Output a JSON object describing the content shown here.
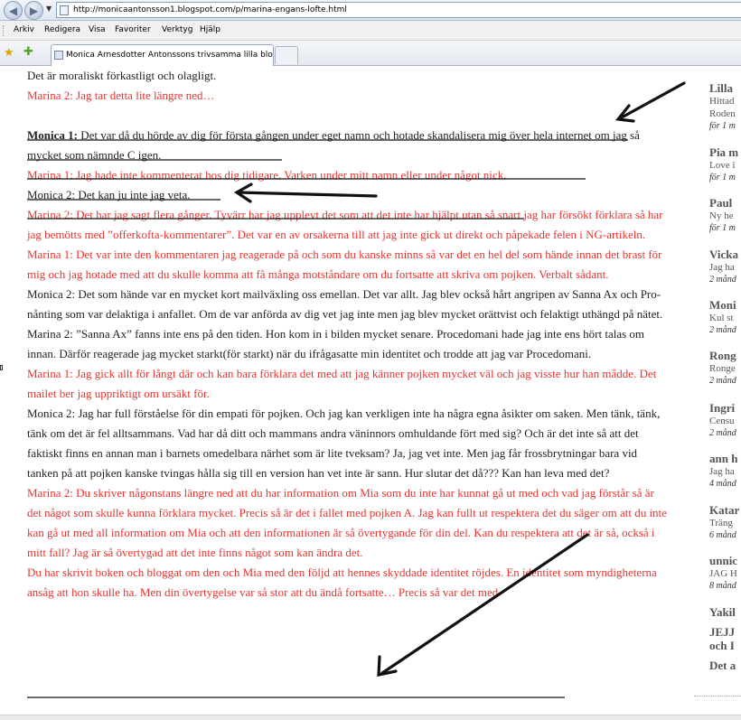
{
  "browser": {
    "url": "http://monicaantonsson1.blogspot.com/p/marina-engans-lofte.html",
    "menu": [
      "Arkiv",
      "Redigera",
      "Visa",
      "Favoriter",
      "Verktyg",
      "Hjälp"
    ],
    "tab_title": "Monica Arnesdotter Antonssons trivsamma lilla blogg: ...",
    "icons": {
      "back": "back-arrow-icon",
      "forward": "forward-arrow-icon",
      "favorites": "star-icon",
      "add_favorite": "add-favorite-icon"
    }
  },
  "content": {
    "paragraphs": [
      {
        "text": "Det är moraliskt förkastligt och olagligt.",
        "color": "#222222"
      },
      {
        "text": "Marina 2: Jag tar detta lite längre ned…",
        "color": "#e8342f"
      },
      {
        "text": "",
        "color": "#222222"
      },
      {
        "speaker": "Monica 1:",
        "text": " Det var då du hörde av dig för första gången under eget namn och hotade skandalisera mig över hela internet om jag så mycket som nämnde C igen.",
        "color": "#222222"
      },
      {
        "text": "Marina 1: Jag hade inte kommenterat hos dig tidigare. Varken under mitt namn eller under något nick.",
        "color": "#e8342f"
      },
      {
        "text": "Monica 2: Det kan ju inte jag veta.",
        "color": "#222222"
      },
      {
        "text": "Marina 2: Det har jag sagt flera gånger. Tyvärr har jag upplevt det som att det inte har hjälpt utan så snart jag har försökt förklara så har jag bemötts med ”offerkofta-kommentarer”. Det var en av orsakerna till att jag inte gick ut direkt och påpekade felen i NG-artikeln.",
        "color": "#e8342f"
      },
      {
        "text": "Marina 1: Det var inte den kommentaren jag reagerade på och som du kanske minns så var det en hel del som hände innan det brast för mig och jag hotade med att du skulle komma att få många motståndare om du fortsatte att skriva om pojken. Verbalt sådant.",
        "color": "#e8342f"
      },
      {
        "text": "Monica 2: Det som hände var en mycket kort mailväxling oss emellan. Det var allt. Jag blev också hårt angripen av Sanna Ax och Pro-nånting som var delaktiga i anfallet. Om de var anförda av dig vet jag inte men jag blev mycket orättvist och felaktigt uthängd på nätet.",
        "color": "#222222"
      },
      {
        "text": "Marina 2: ”Sanna Ax” fanns inte ens på den tiden. Hon kom in i bilden mycket senare. Procedomani hade jag inte ens hört talas om innan. Därför reagerade jag mycket starkt(för starkt) när du ifrågasatte min identitet och trodde att jag var Procedomani.",
        "color": "#222222"
      },
      {
        "text": "Marina 1: Jag gick allt för långt där och kan bara förklara det med att jag känner pojken mycket väl och jag visste hur han mådde. Det mailet ber jag uppriktigt om ursäkt för.",
        "color": "#e8342f"
      },
      {
        "text": "Monica 2: Jag har full förståelse för din empati för pojken. Och jag kan verkligen inte ha några egna åsikter om saken. Men tänk, tänk, tänk om det är fel alltsammans. Vad har då ditt och mammans andra väninnors omhuldande fört med sig? Och är det inte så att det faktiskt finns en annan man i barnets omedelbara närhet som är lite tveksam? Ja, jag vet inte. Men jag får frossbrytningar bara vid tanken på att pojken kanske tvingas hålla sig till en version han vet inte är sann. Hur slutar det då??? Kan han leva med det?",
        "color": "#222222"
      },
      {
        "text": "Marina 2: Du skriver någonstans längre ned att du har information om Mia som du inte har kunnat gå ut med och vad jag förstår så är det något som skulle kunna förklara mycket. Precis så är det i fallet med pojken A. Jag kan fullt ut respektera det du säger om att du inte kan gå ut med all information om Mia och att den informationen är så övertygande för din del. Kan du respektera att det är så, också i mitt fall? Jag är så övertygad att det inte finns något som kan ändra det.",
        "color": "#e8342f"
      },
      {
        "text": "Du har skrivit boken och bloggat om den och Mia med den följd att hennes skyddade identitet röjdes. En identitet som myndigheterna ansåg att hon skulle ha. Men din övertygelse var så stor att du ändå fortsatte… Precis så var det med",
        "color": "#e8342f"
      }
    ]
  },
  "sidebar": {
    "entries": [
      {
        "name": "Lilla",
        "lines": [
          "Hittad",
          "Roden"
        ],
        "time": "för 1 m"
      },
      {
        "name": "Pia m",
        "lines": [
          "Love i"
        ],
        "time": "för 1 m"
      },
      {
        "name": "Paul",
        "lines": [
          "Ny he"
        ],
        "time": "för 1 m"
      },
      {
        "name": "Vicka",
        "lines": [
          "Jag ha"
        ],
        "time": "2 månd"
      },
      {
        "name": "Moni",
        "lines": [
          "Kul st"
        ],
        "time": "2 månd"
      },
      {
        "name": "Rong",
        "lines": [
          "Ronge"
        ],
        "time": "2 månd"
      },
      {
        "name": "Ingri",
        "lines": [
          "Censu"
        ],
        "time": "2 månd"
      },
      {
        "name": "ann h",
        "lines": [
          "Jag ha"
        ],
        "time": "4 månd"
      },
      {
        "name": "Katar",
        "lines": [
          "Träng"
        ],
        "time": "6 månd"
      },
      {
        "name": "unnic",
        "lines": [
          "JAG H"
        ],
        "time": "8 månd"
      },
      {
        "name": "Yakil",
        "lines": [],
        "time": ""
      },
      {
        "name": "JEJJ",
        "lines": [],
        "time": ""
      },
      {
        "name": "och I",
        "lines": [],
        "time": ""
      },
      {
        "name": "Det a",
        "lines": [],
        "time": ""
      }
    ]
  }
}
